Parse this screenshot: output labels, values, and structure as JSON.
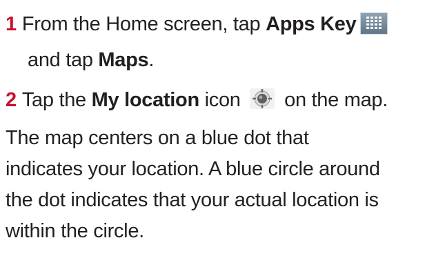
{
  "steps": [
    {
      "number": "1",
      "text_before": "From the Home screen, tap ",
      "bold_1": "Apps Key",
      "icon_1": "apps-grid-icon",
      "continuation_before": "and tap ",
      "bold_2": "Maps",
      "continuation_after": "."
    },
    {
      "number": "2",
      "text_before": "Tap the ",
      "bold_1": "My location",
      "text_middle": " icon ",
      "icon_1": "my-location-icon",
      "text_after": " on the map."
    }
  ],
  "paragraph": {
    "lines": [
      "The map centers on a blue dot that",
      "indicates your location. A blue circle around",
      "the dot indicates that your actual location is",
      "within the circle."
    ]
  },
  "colors": {
    "step_number": "#c8102e",
    "text": "#231f20"
  }
}
